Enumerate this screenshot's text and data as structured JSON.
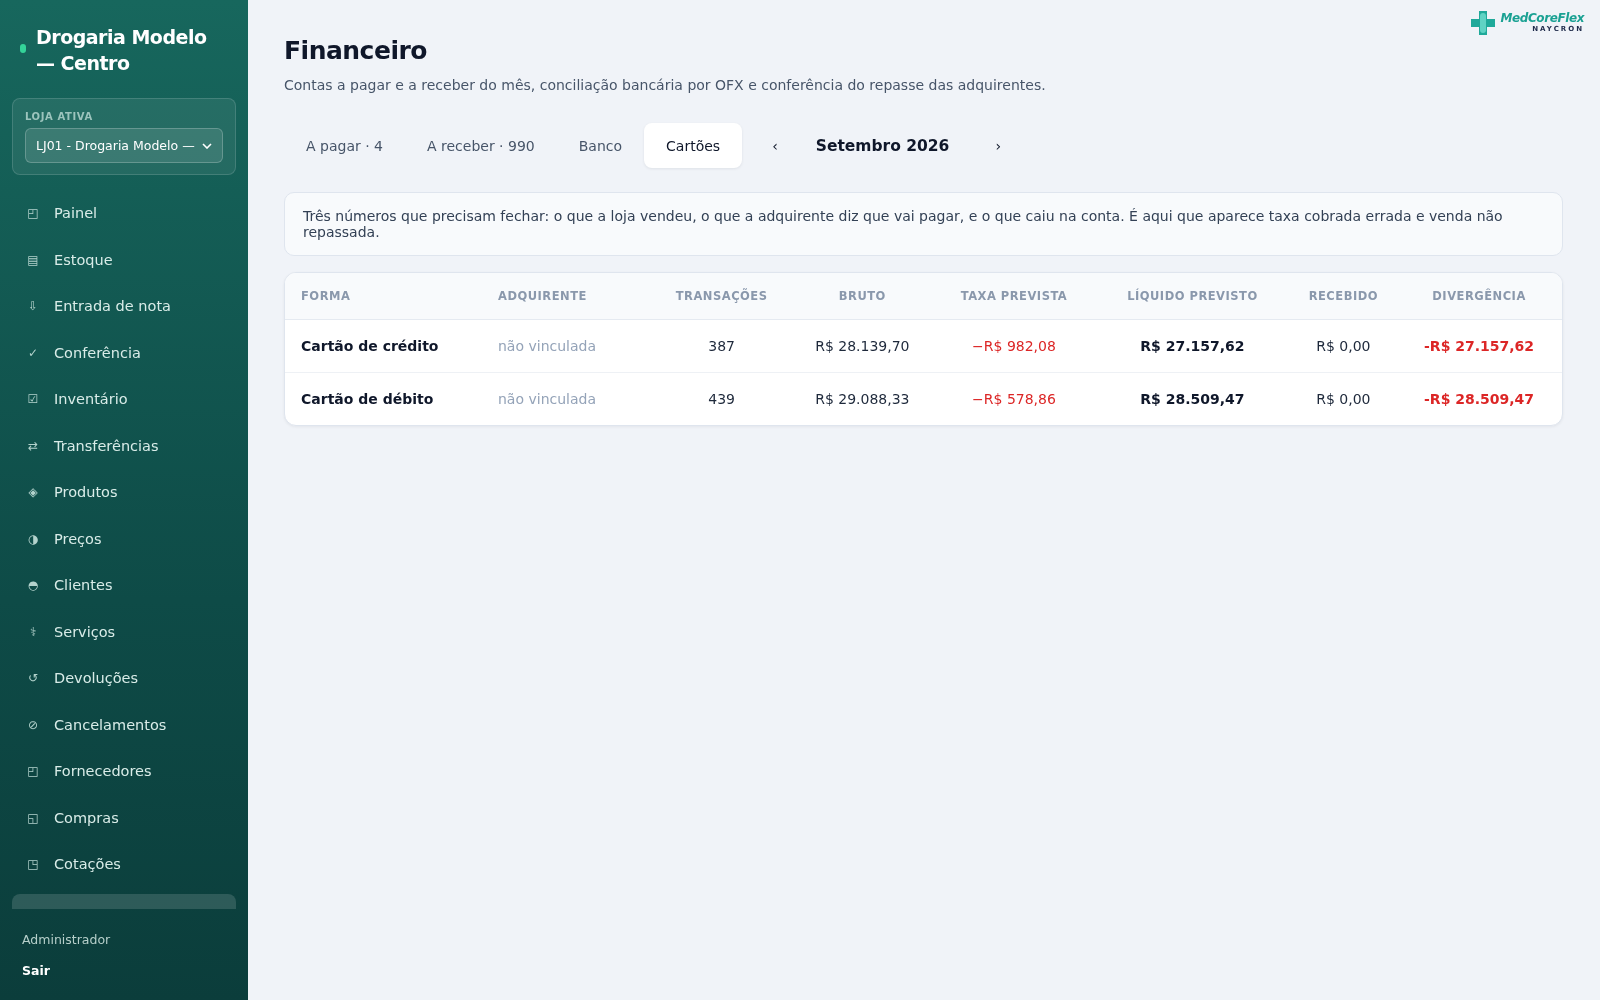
{
  "sidebar": {
    "brand": "Drogaria Modelo — Centro",
    "store_label": "LOJA ATIVA",
    "store_select": "LJ01 - Drogaria Modelo —",
    "items": [
      {
        "icon": "◰",
        "label": "Painel"
      },
      {
        "icon": "▤",
        "label": "Estoque"
      },
      {
        "icon": "⇩",
        "label": "Entrada de nota"
      },
      {
        "icon": "✓",
        "label": "Conferência"
      },
      {
        "icon": "☑",
        "label": "Inventário"
      },
      {
        "icon": "⇄",
        "label": "Transferências"
      },
      {
        "icon": "◈",
        "label": "Produtos"
      },
      {
        "icon": "◑",
        "label": "Preços"
      },
      {
        "icon": "◓",
        "label": "Clientes"
      },
      {
        "icon": "⚕",
        "label": "Serviços"
      },
      {
        "icon": "↺",
        "label": "Devoluções"
      },
      {
        "icon": "⊘",
        "label": "Cancelamentos"
      },
      {
        "icon": "◰",
        "label": "Fornecedores"
      },
      {
        "icon": "◱",
        "label": "Compras"
      },
      {
        "icon": "◳",
        "label": "Cotações"
      }
    ],
    "user": "Administrador",
    "logout": "Sair"
  },
  "logo": {
    "name": "MedCoreFlex",
    "sub": "NAYCRON"
  },
  "page": {
    "title": "Financeiro",
    "subtitle": "Contas a pagar e a receber do mês, conciliação bancária por OFX e conferência do repasse das adquirentes."
  },
  "tabs": [
    {
      "label": "A pagar · 4",
      "selected": false
    },
    {
      "label": "A receber · 990",
      "selected": false
    },
    {
      "label": "Banco",
      "selected": false
    },
    {
      "label": "Cartões",
      "selected": true
    }
  ],
  "month": {
    "prev": "‹",
    "label": "Setembro 2026",
    "next": "›"
  },
  "notice": "Três números que precisam fechar: o que a loja vendeu, o que a adquirente diz que vai pagar, e o que caiu na conta. É aqui que aparece taxa cobrada errada e venda não repassada.",
  "table": {
    "columns": [
      "FORMA",
      "ADQUIRENTE",
      "TRANSAÇÕES",
      "BRUTO",
      "TAXA PREVISTA",
      "LÍQUIDO PREVISTO",
      "RECEBIDO",
      "DIVERGÊNCIA"
    ],
    "rows": [
      {
        "cells": [
          "Cartão de crédito",
          "não vinculada",
          "387",
          "R$ 28.139,70",
          "−R$ 982,08",
          "R$ 27.157,62",
          "R$ 0,00",
          "-R$ 27.157,62"
        ]
      },
      {
        "cells": [
          "Cartão de débito",
          "não vinculada",
          "439",
          "R$ 29.088,33",
          "−R$ 578,86",
          "R$ 28.509,47",
          "R$ 0,00",
          "-R$ 28.509,47"
        ]
      }
    ]
  }
}
